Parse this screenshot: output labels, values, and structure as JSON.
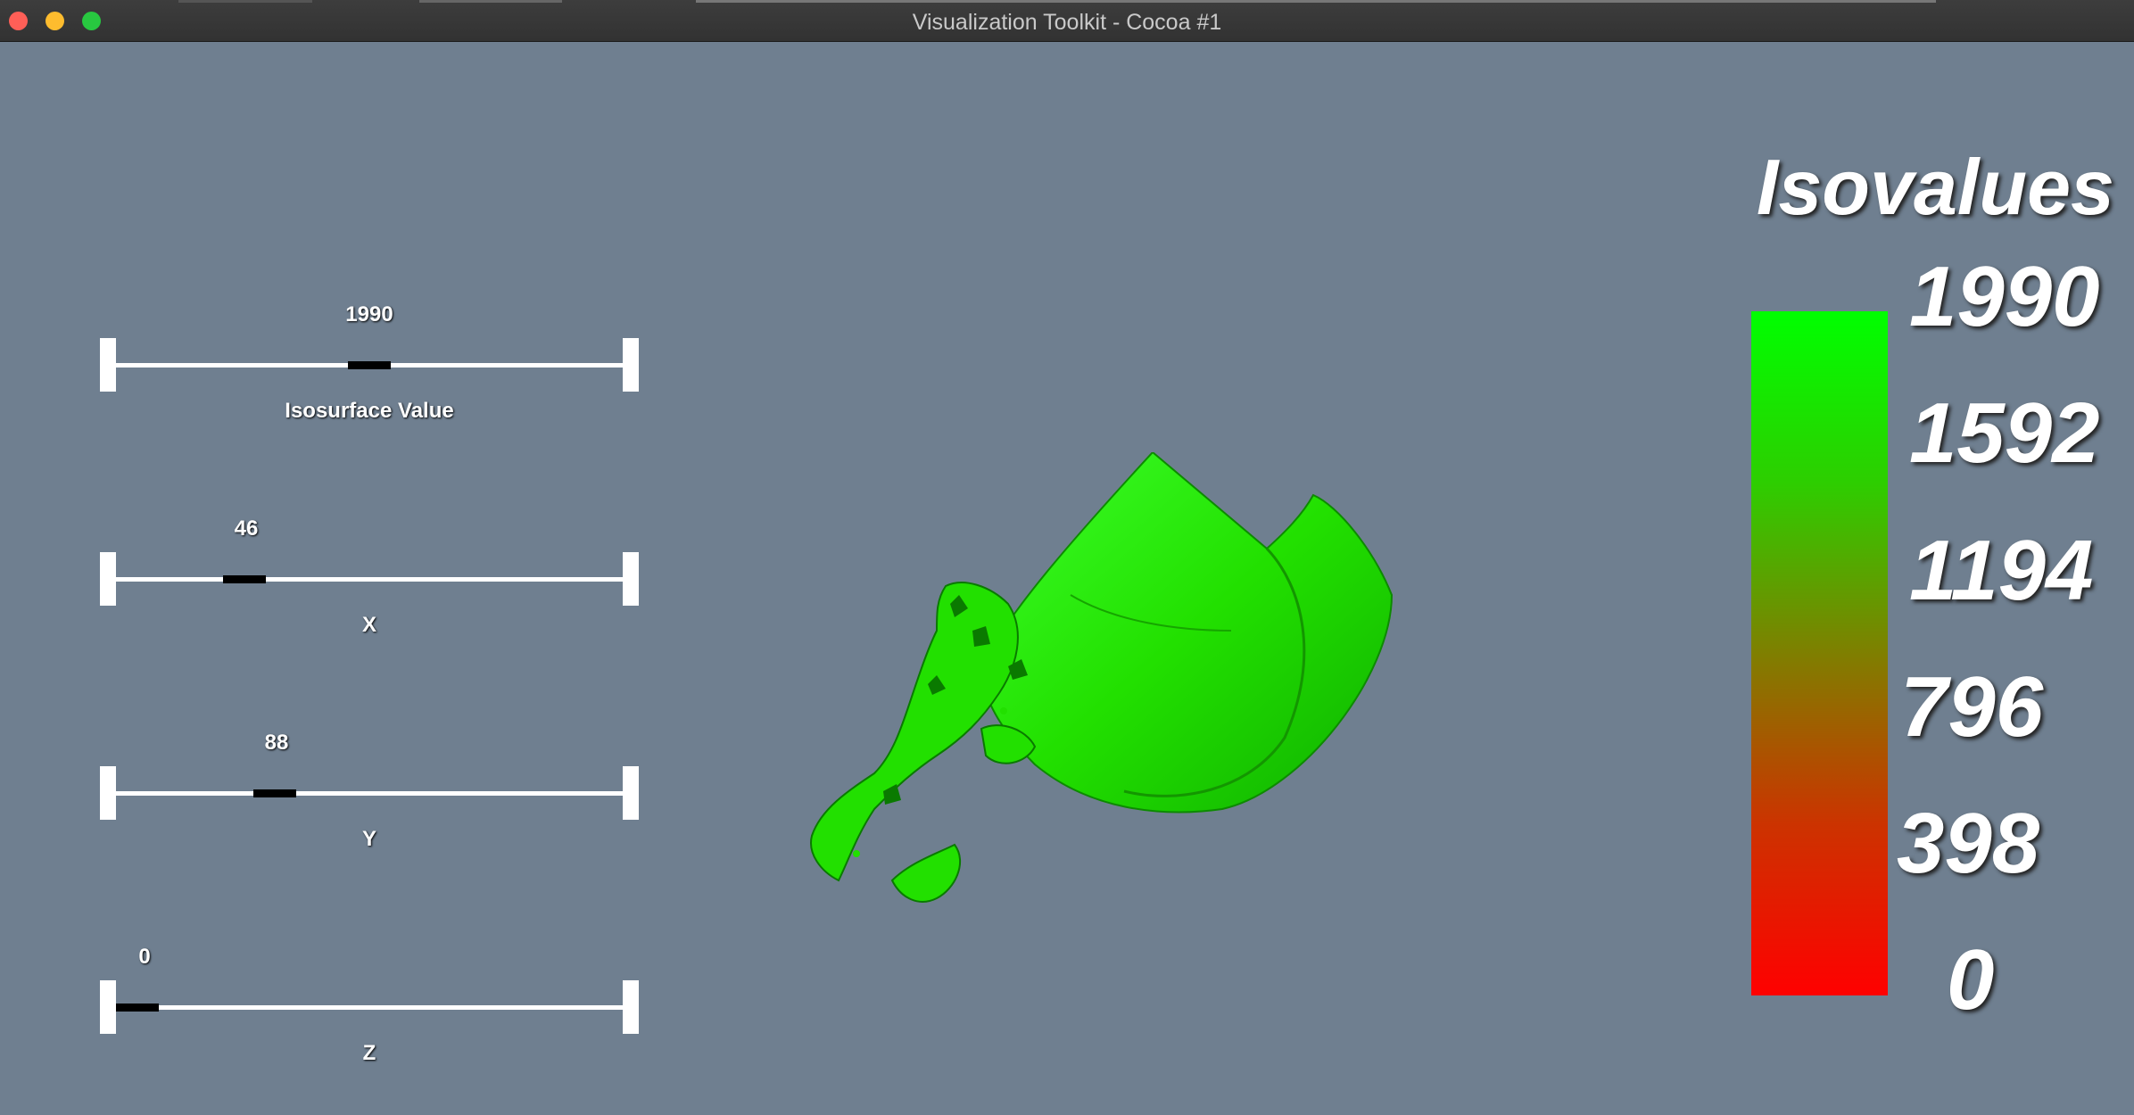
{
  "window": {
    "title": "Visualization Toolkit - Cocoa #1"
  },
  "colors": {
    "background": "#6f7f90",
    "surface": "#22e000",
    "high": "#00ff00",
    "low": "#ff0000"
  },
  "sliders": [
    {
      "value": "1990",
      "label": "Isosurface Value",
      "fraction": 0.5
    },
    {
      "value": "46",
      "label": "X",
      "fraction": 0.26
    },
    {
      "value": "88",
      "label": "Y",
      "fraction": 0.32
    },
    {
      "value": "0",
      "label": "Z",
      "fraction": 0.0
    }
  ],
  "legend": {
    "title": "Isovalues",
    "ticks": [
      "1990",
      "1592",
      "1194",
      "796",
      "398",
      "0"
    ]
  }
}
